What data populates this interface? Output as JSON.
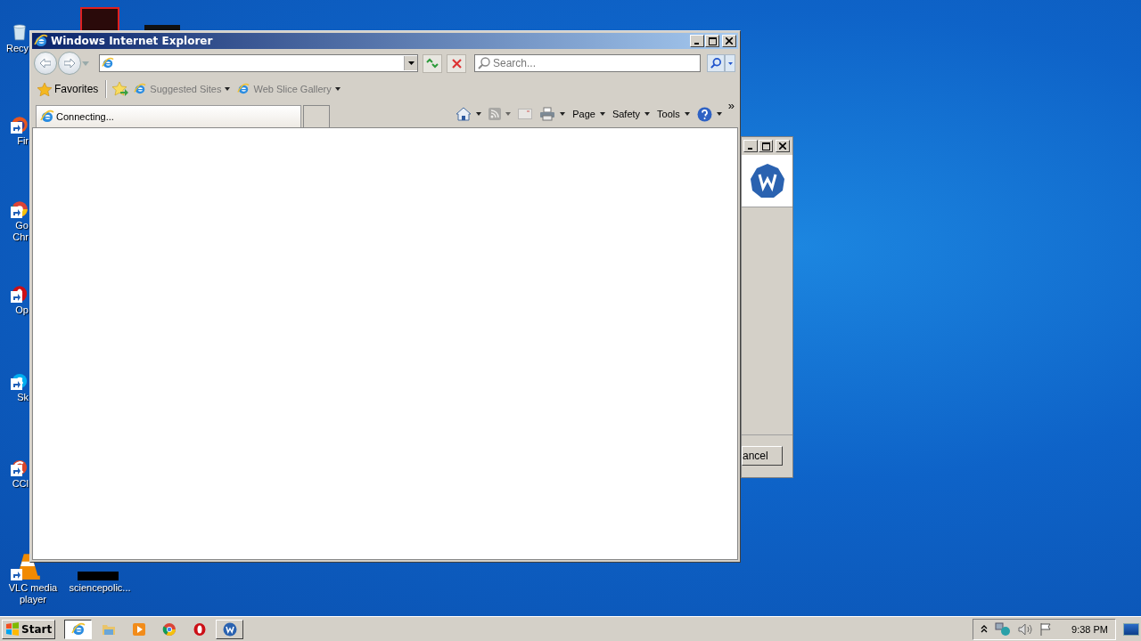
{
  "desktop_icons": [
    {
      "kind": "recycle",
      "lines": [
        "Recy"
      ],
      "shortcut": false
    },
    {
      "kind": "firefox",
      "lines": [
        "Fir"
      ],
      "shortcut": true
    },
    {
      "kind": "chrome",
      "lines": [
        "Go",
        "Chr"
      ],
      "shortcut": true
    },
    {
      "kind": "opera",
      "lines": [
        "Op"
      ],
      "shortcut": true
    },
    {
      "kind": "skype",
      "lines": [
        "Sk"
      ],
      "shortcut": true
    },
    {
      "kind": "ccleaner",
      "lines": [
        "CCl"
      ],
      "shortcut": true
    },
    {
      "kind": "vlc",
      "lines": [
        "VLC media",
        "player"
      ],
      "shortcut": true
    },
    {
      "kind": "file",
      "lines": [
        "sciencepolic..."
      ],
      "shortcut": false
    }
  ],
  "browser": {
    "window": {
      "title": "Windows Internet Explorer",
      "active": true
    },
    "search": {
      "placeholder": "Search..."
    },
    "favorites_bar": {
      "label": "Favorites",
      "items": [
        {
          "label": "Suggested Sites",
          "disabled": true
        },
        {
          "label": "Web Slice Gallery",
          "disabled": true
        }
      ]
    },
    "tabs": [
      {
        "label": "Connecting...",
        "selected": true
      }
    ],
    "command_bar": [
      {
        "kind": "home",
        "disabled": false
      },
      {
        "kind": "feeds",
        "disabled": true
      },
      {
        "kind": "mail",
        "disabled": true
      },
      {
        "kind": "print",
        "disabled": false
      },
      {
        "kind": "menu",
        "label": "Page",
        "disabled": false
      },
      {
        "kind": "menu",
        "label": "Safety",
        "disabled": false
      },
      {
        "kind": "menu",
        "label": "Tools",
        "disabled": false
      },
      {
        "kind": "help",
        "disabled": false
      }
    ],
    "overflow": "»"
  },
  "background_window": {
    "button": "ancel"
  },
  "taskbar": {
    "start": "Start",
    "items": [
      {
        "kind": "ie",
        "selected": true
      },
      {
        "kind": "folder",
        "selected": false
      },
      {
        "kind": "media",
        "selected": false
      },
      {
        "kind": "chrome",
        "selected": false
      },
      {
        "kind": "opera",
        "selected": false
      },
      {
        "kind": "wise",
        "selected": false
      }
    ],
    "clock": "9:38 PM"
  }
}
